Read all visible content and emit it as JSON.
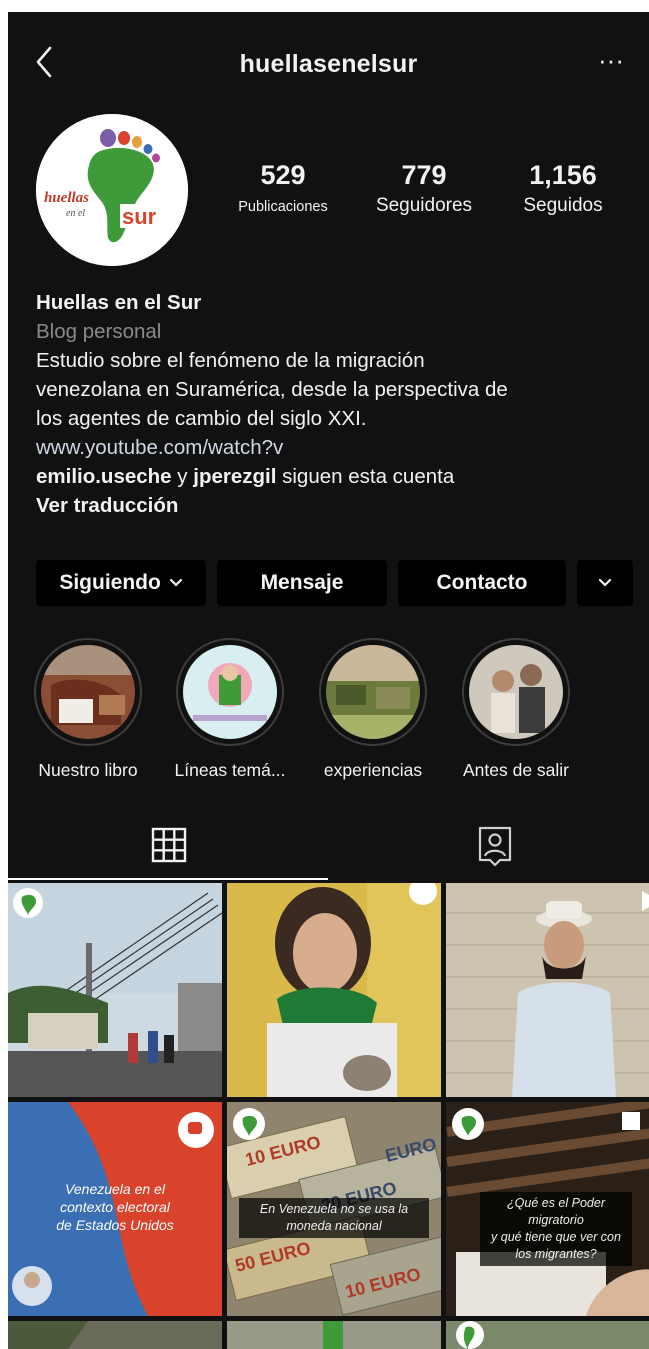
{
  "header": {
    "title": "huellasenelsur",
    "back_icon": "chevron-left-icon",
    "more_label": "···"
  },
  "profile": {
    "avatar_text": {
      "left": "huellas",
      "sub": "en el",
      "right": "sur"
    },
    "stats": {
      "posts": {
        "value": "529",
        "label": "Publicaciones"
      },
      "followers": {
        "value": "779",
        "label": "Seguidores"
      },
      "following": {
        "value": "1,156",
        "label": "Seguidos"
      }
    },
    "name": "Huellas en el Sur",
    "category": "Blog personal",
    "bio_lines": [
      "Estudio sobre el fenómeno de la migración",
      "venezolana en Suramérica, desde la perspectiva de",
      "los agentes de cambio del siglo XXI."
    ],
    "link": "www.youtube.com/watch?v",
    "followed_by": {
      "user1": "emilio.useche",
      "connector": " y ",
      "user2": "jperezgil",
      "suffix": " siguen esta cuenta"
    },
    "translate": "Ver traducción"
  },
  "actions": {
    "following": "Siguiendo",
    "message": "Mensaje",
    "contact": "Contacto"
  },
  "highlights": [
    {
      "label": "Nuestro libro"
    },
    {
      "label": "Líneas temá..."
    },
    {
      "label": "experiencias"
    },
    {
      "label": "Antes de salir"
    }
  ],
  "posts": {
    "p4_text": [
      "Venezuela en el",
      "contexto electoral",
      "de Estados Unidos"
    ],
    "p5_text": [
      "En Venezuela no se usa la",
      "moneda nacional"
    ],
    "p6_text": [
      "¿Qué es el Poder migratorio",
      "y qué tiene que ver con",
      "los migrantes?"
    ],
    "p5_bills": [
      "10 EURO",
      "20 EURO",
      "50 EURO",
      "10 EURO",
      "EURO"
    ]
  },
  "colors": {
    "background": "#111111",
    "button": "#000000",
    "accent_green": "#3f9a3a",
    "flag_red": "#d9432c",
    "flag_blue": "#3a6fb3"
  }
}
